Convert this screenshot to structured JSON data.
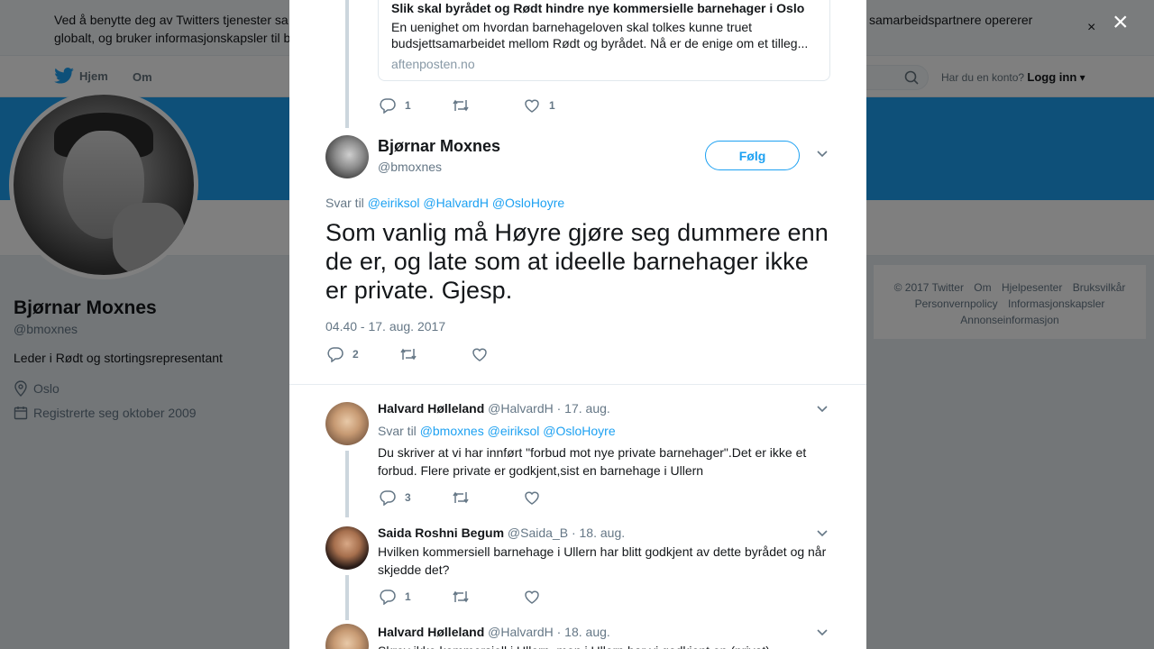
{
  "cookie_bar": {
    "text": "Ved å benytte deg av Twitters tjenester sa                                                                                                                     samarbeidspartnere opererer globalt, og bruker informasjonskapsler til b",
    "text_left": "Ved å benytte deg av Twitters tjenester sa",
    "text_right": "samarbeidspartnere opererer",
    "text_line2": "globalt, og bruker informasjonskapsler til b",
    "close": "×"
  },
  "nav": {
    "home": "Hjem",
    "about": "Om",
    "login_prompt": "Har du en konto?",
    "login": "Logg inn"
  },
  "profile": {
    "name": "Bjørnar Moxnes",
    "handle": "@bmoxnes",
    "bio": "Leder i Rødt og stortingsrepresentant",
    "location": "Oslo",
    "joined": "Registrerte seg oktober 2009"
  },
  "footer": {
    "items": [
      "© 2017 Twitter",
      "Om",
      "Hjelpesenter",
      "Bruksvilkår",
      "Personvernpolicy",
      "Informasjonskapsler",
      "Annonseinformasjon"
    ]
  },
  "overlay_close": "×",
  "card": {
    "title": "Slik skal byrådet og Rødt hindre nye kommersielle barnehager i Oslo",
    "description": "En uenighet om hvordan barnehageloven skal tolkes kunne truet budsjettsamarbeidet mellom Rødt og byrådet. Nå er de enige om et tilleg...",
    "domain": "aftenposten.no",
    "replies": "1",
    "retweets": "",
    "likes": "1"
  },
  "main_tweet": {
    "name": "Bjørnar Moxnes",
    "handle": "@bmoxnes",
    "follow": "Følg",
    "reply_label": "Svar til",
    "mentions": [
      "@eiriksol",
      "@HalvardH",
      "@OsloHoyre"
    ],
    "text": "Som vanlig må Høyre gjøre seg dummere enn de er, og late som at ideelle barnehager ikke er private. Gjesp.",
    "timestamp": "04.40 - 17. aug. 2017",
    "replies": "2",
    "retweets": "",
    "likes": ""
  },
  "replies": [
    {
      "name": "Halvard Hølleland",
      "handle": "@HalvardH",
      "date": "· 17. aug.",
      "reply_label": "Svar til",
      "mentions": [
        "@bmoxnes",
        "@eiriksol",
        "@OsloHoyre"
      ],
      "text": "Du skriver at vi har innført \"forbud mot nye private barnehager\".Det er ikke et forbud. Flere private er godkjent,sist en barnehage i Ullern",
      "replies": "3"
    },
    {
      "name": "Saida Roshni Begum",
      "handle": "@Saida_B",
      "date": "· 18. aug.",
      "text": "Hvilken kommersiell barnehage i Ullern har blitt godkjent av dette byrådet og når skjedde det?",
      "replies": "1"
    },
    {
      "name": "Halvard Hølleland",
      "handle": "@HalvardH",
      "date": "· 18. aug.",
      "text": "Skrev ikke kommersiell i Ullern, men i Ullern har vi godkjent en (privat)"
    }
  ]
}
